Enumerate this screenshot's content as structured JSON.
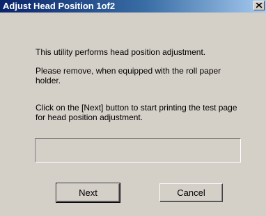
{
  "window": {
    "title": "Adjust Head Position 1of2",
    "close_icon": "close-icon"
  },
  "body": {
    "line1": "This utility performs head position adjustment.",
    "line2": "Please remove, when equipped with the roll paper holder.",
    "line3": "Click on the [Next] button to start printing the test page for head position adjustment."
  },
  "progress": {
    "value_percent": 0
  },
  "buttons": {
    "next_label": "Next",
    "cancel_label": "Cancel"
  },
  "colors": {
    "dialog_bg": "#d4d0c8",
    "title_active": "#0a246a",
    "title_text": "#ffffff"
  }
}
